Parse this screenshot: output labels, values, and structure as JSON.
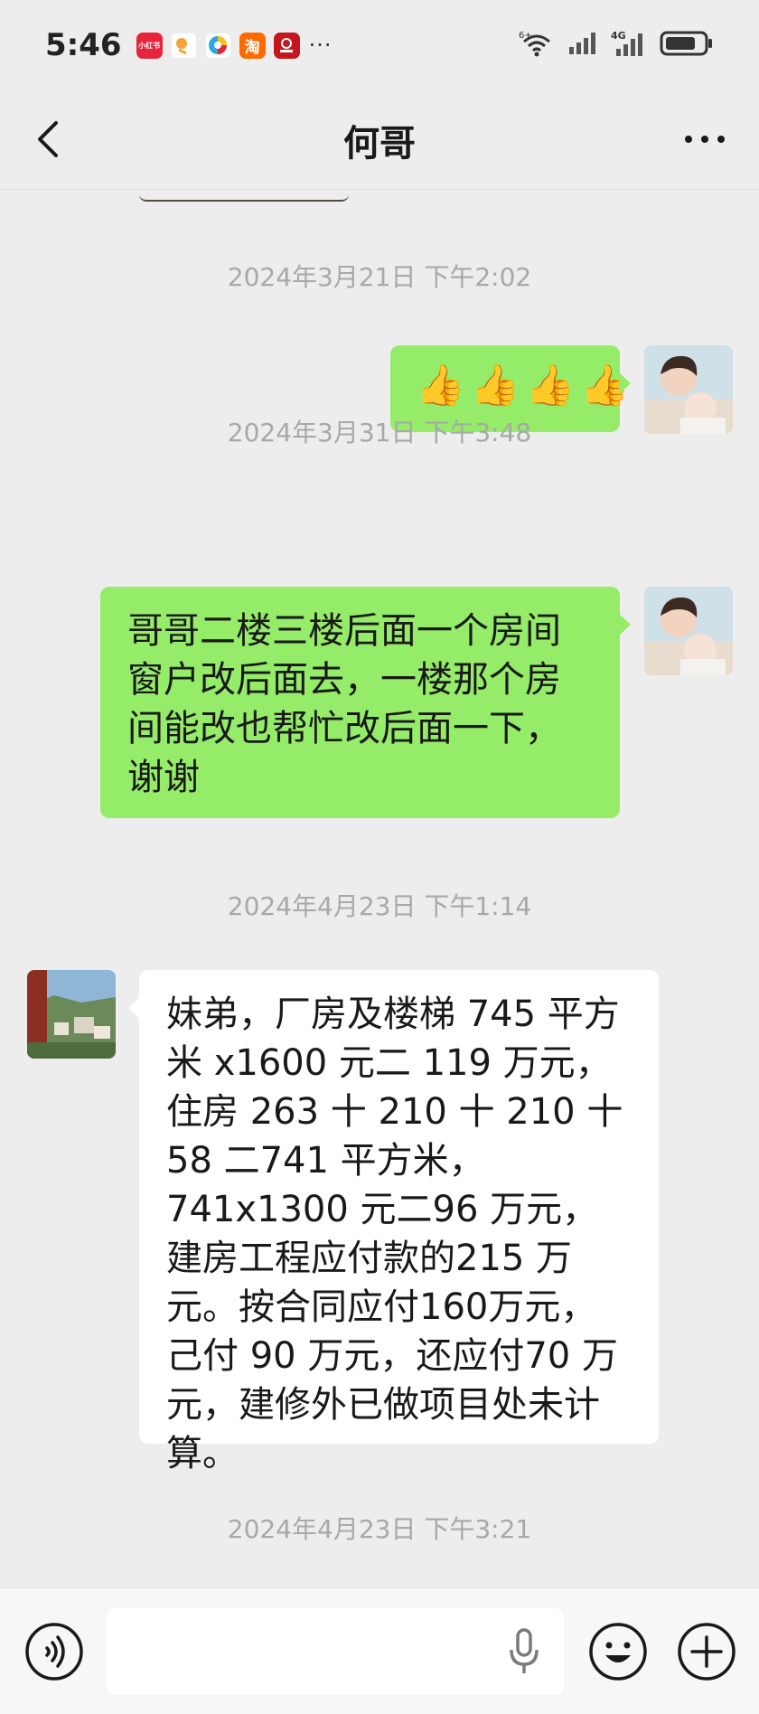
{
  "status_bar": {
    "time": "5:46",
    "app_icons": [
      {
        "name": "xiaohongshu-icon",
        "label": "小红书",
        "color": "#e8243c"
      },
      {
        "name": "app-orange-icon",
        "label": "",
        "color": "#f7a13a"
      },
      {
        "name": "app-color-icon",
        "label": "",
        "color": "#ffffff"
      },
      {
        "name": "taobao-icon",
        "label": "淘",
        "color": "#ff6a00"
      },
      {
        "name": "app-red-icon",
        "label": "",
        "color": "#c4161c"
      }
    ],
    "more": "···",
    "network": "4G",
    "wifi_badge": "6+"
  },
  "nav": {
    "title": "何哥",
    "back_icon": "chevron-left-icon",
    "more_icon": "more-dots-icon"
  },
  "messages": [
    {
      "type": "time",
      "text": "2024年3月21日 下午2:02"
    },
    {
      "type": "sent",
      "emoji": [
        "👍",
        "👍",
        "👍",
        "👍"
      ]
    },
    {
      "type": "time",
      "text": "2024年3月31日 下午3:48"
    },
    {
      "type": "sent",
      "text": "哥哥二楼三楼后面一个房间窗户改后面去，一楼那个房间能改也帮忙改后面一下，谢谢"
    },
    {
      "type": "time",
      "text": "2024年4月23日 下午1:14"
    },
    {
      "type": "received",
      "text": "妹弟，厂房及楼梯 745 平方米 x1600 元二 119 万元，住房 263 十 210 十 210 十 58 二741 平方米，741x1300 元二96 万元，建房工程应付款的215 万元。按合同应付160万元，己付 90 万元，还应付70 万元，建修外已做项目处未计算。"
    },
    {
      "type": "time",
      "text": "2024年4月23日 下午3:21"
    }
  ],
  "colors": {
    "sent_bubble": "#95ec69",
    "received_bubble": "#ffffff",
    "background": "#ededed"
  },
  "input_bar": {
    "voice_icon": "voice-icon",
    "mic_icon": "microphone-icon",
    "emoji_icon": "emoji-icon",
    "plus_icon": "plus-icon"
  }
}
